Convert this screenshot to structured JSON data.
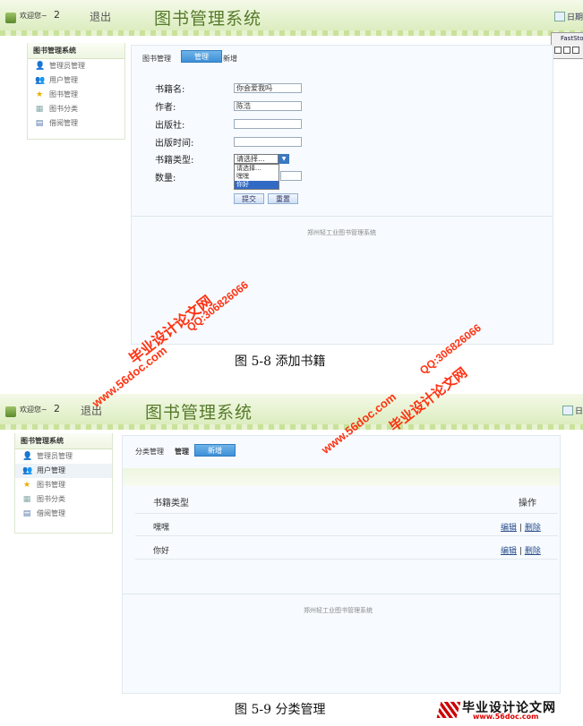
{
  "screenshot1": {
    "header": {
      "welcome": "欢迎您~",
      "username": "2",
      "logout": "退出",
      "title": "图书管理系统",
      "right_link": "日期"
    },
    "floating_toolbar": {
      "title": "FastSto"
    },
    "sidebar": {
      "title": "图书管理系统",
      "items": [
        {
          "label": "管理员管理",
          "icon": "admin-icon"
        },
        {
          "label": "用户管理",
          "icon": "user-icon"
        },
        {
          "label": "图书管理",
          "icon": "star-icon"
        },
        {
          "label": "图书分类",
          "icon": "grid-icon"
        },
        {
          "label": "借阅管理",
          "icon": "card-icon"
        }
      ]
    },
    "toolbar": {
      "label": "图书管理",
      "manage": "管理",
      "new": "新增"
    },
    "form": {
      "name_label": "书籍名:",
      "name_value": "你会爱我吗",
      "author_label": "作者:",
      "author_value": "陈浩",
      "publisher_label": "出版社:",
      "publisher_value": "",
      "pubdate_label": "出版时间:",
      "pubdate_value": "",
      "type_label": "书籍类型:",
      "type_selected": "请选择...",
      "type_options": [
        "请选择...",
        "嘿嘿",
        "你好"
      ],
      "qty_label": "数量:",
      "submit": "提交",
      "reset": "重置"
    },
    "footer": "郑州轻工业图书管理系统"
  },
  "caption1": "图 5-8 添加书籍",
  "screenshot2": {
    "header": {
      "welcome": "欢迎您~",
      "username": "2",
      "logout": "退出",
      "title": "图书管理系统",
      "right_link": "日"
    },
    "sidebar": {
      "title": "图书管理系统",
      "items": [
        {
          "label": "管理员管理",
          "icon": "admin-icon"
        },
        {
          "label": "用户管理",
          "icon": "user-icon"
        },
        {
          "label": "图书管理",
          "icon": "star-icon"
        },
        {
          "label": "图书分类",
          "icon": "grid-icon"
        },
        {
          "label": "借阅管理",
          "icon": "card-icon"
        }
      ]
    },
    "toolbar": {
      "label": "分类管理",
      "manage": "管理",
      "new": "新增"
    },
    "table": {
      "col_type": "书籍类型",
      "col_op": "操作",
      "rows": [
        {
          "name": "嘿嘿",
          "edit": "编辑",
          "sep": "|",
          "del": "删除"
        },
        {
          "name": "你好",
          "edit": "编辑",
          "sep": "|",
          "del": "删除"
        }
      ]
    },
    "footer": "郑州轻工业图书管理系统"
  },
  "caption2": "图 5-9 分类管理",
  "watermarks": {
    "site_name": "毕业设计论文网",
    "url": "www.56doc.com",
    "qq": "QQ:306826066"
  },
  "logo": {
    "name": "毕业设计论文网",
    "url": "www.56doc.com"
  }
}
